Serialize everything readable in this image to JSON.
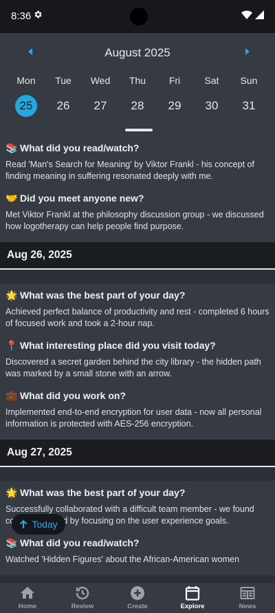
{
  "status_bar": {
    "time": "8:36"
  },
  "calendar": {
    "month_title": "August 2025",
    "weekdays": [
      "Mon",
      "Tue",
      "Wed",
      "Thu",
      "Fri",
      "Sat",
      "Sun"
    ],
    "dates": [
      "25",
      "26",
      "27",
      "28",
      "29",
      "30",
      "31"
    ],
    "selected_date": "25",
    "accent_color": "#23a8e0"
  },
  "feed": {
    "entry1": {
      "q1": {
        "icon": "books-icon",
        "question": "What did you read/watch?",
        "answer": "Read 'Man's Search for Meaning' by Viktor Frankl - his concept of finding meaning in suffering resonated deeply with me."
      },
      "q2": {
        "icon": "handshake-icon",
        "question": "Did you meet anyone new?",
        "answer": "Met Viktor Frankl at the philosophy discussion group - we discussed how logotherapy can help people find purpose."
      }
    },
    "entry2": {
      "date": "Aug 26, 2025",
      "q1": {
        "icon": "star-icon",
        "question": "What was the best part of your day?",
        "answer": "Achieved perfect balance of productivity and rest - completed 6 hours of focused work and took a 2-hour nap."
      },
      "q2": {
        "icon": "pin-icon",
        "question": "What interesting place did you visit today?",
        "answer": "Discovered a secret garden behind the city library - the hidden path was marked by a small stone with an arrow."
      },
      "q3": {
        "icon": "briefcase-icon",
        "question": "What did you work on?",
        "answer": "Implemented end-to-end encryption for user data - now all personal information is protected with AES-256 encryption."
      }
    },
    "entry3": {
      "date": "Aug 27, 2025",
      "q1": {
        "icon": "star-icon",
        "question": "What was the best part of your day?",
        "answer": "Successfully collaborated with a difficult team member - we found common ground by focusing on the user experience goals."
      },
      "q2": {
        "icon": "books-icon",
        "question": "What did you read/watch?",
        "answer": "Watched 'Hidden Figures' about the African-American women"
      }
    }
  },
  "today_button": {
    "label": "Today"
  },
  "bottom_nav": {
    "items": [
      {
        "label": "Home",
        "icon": "home-icon",
        "active": false
      },
      {
        "label": "Review",
        "icon": "history-icon",
        "active": false
      },
      {
        "label": "Create",
        "icon": "add-circle-icon",
        "active": false
      },
      {
        "label": "Explore",
        "icon": "calendar-icon",
        "active": true
      },
      {
        "label": "News",
        "icon": "news-icon",
        "active": false
      }
    ]
  }
}
